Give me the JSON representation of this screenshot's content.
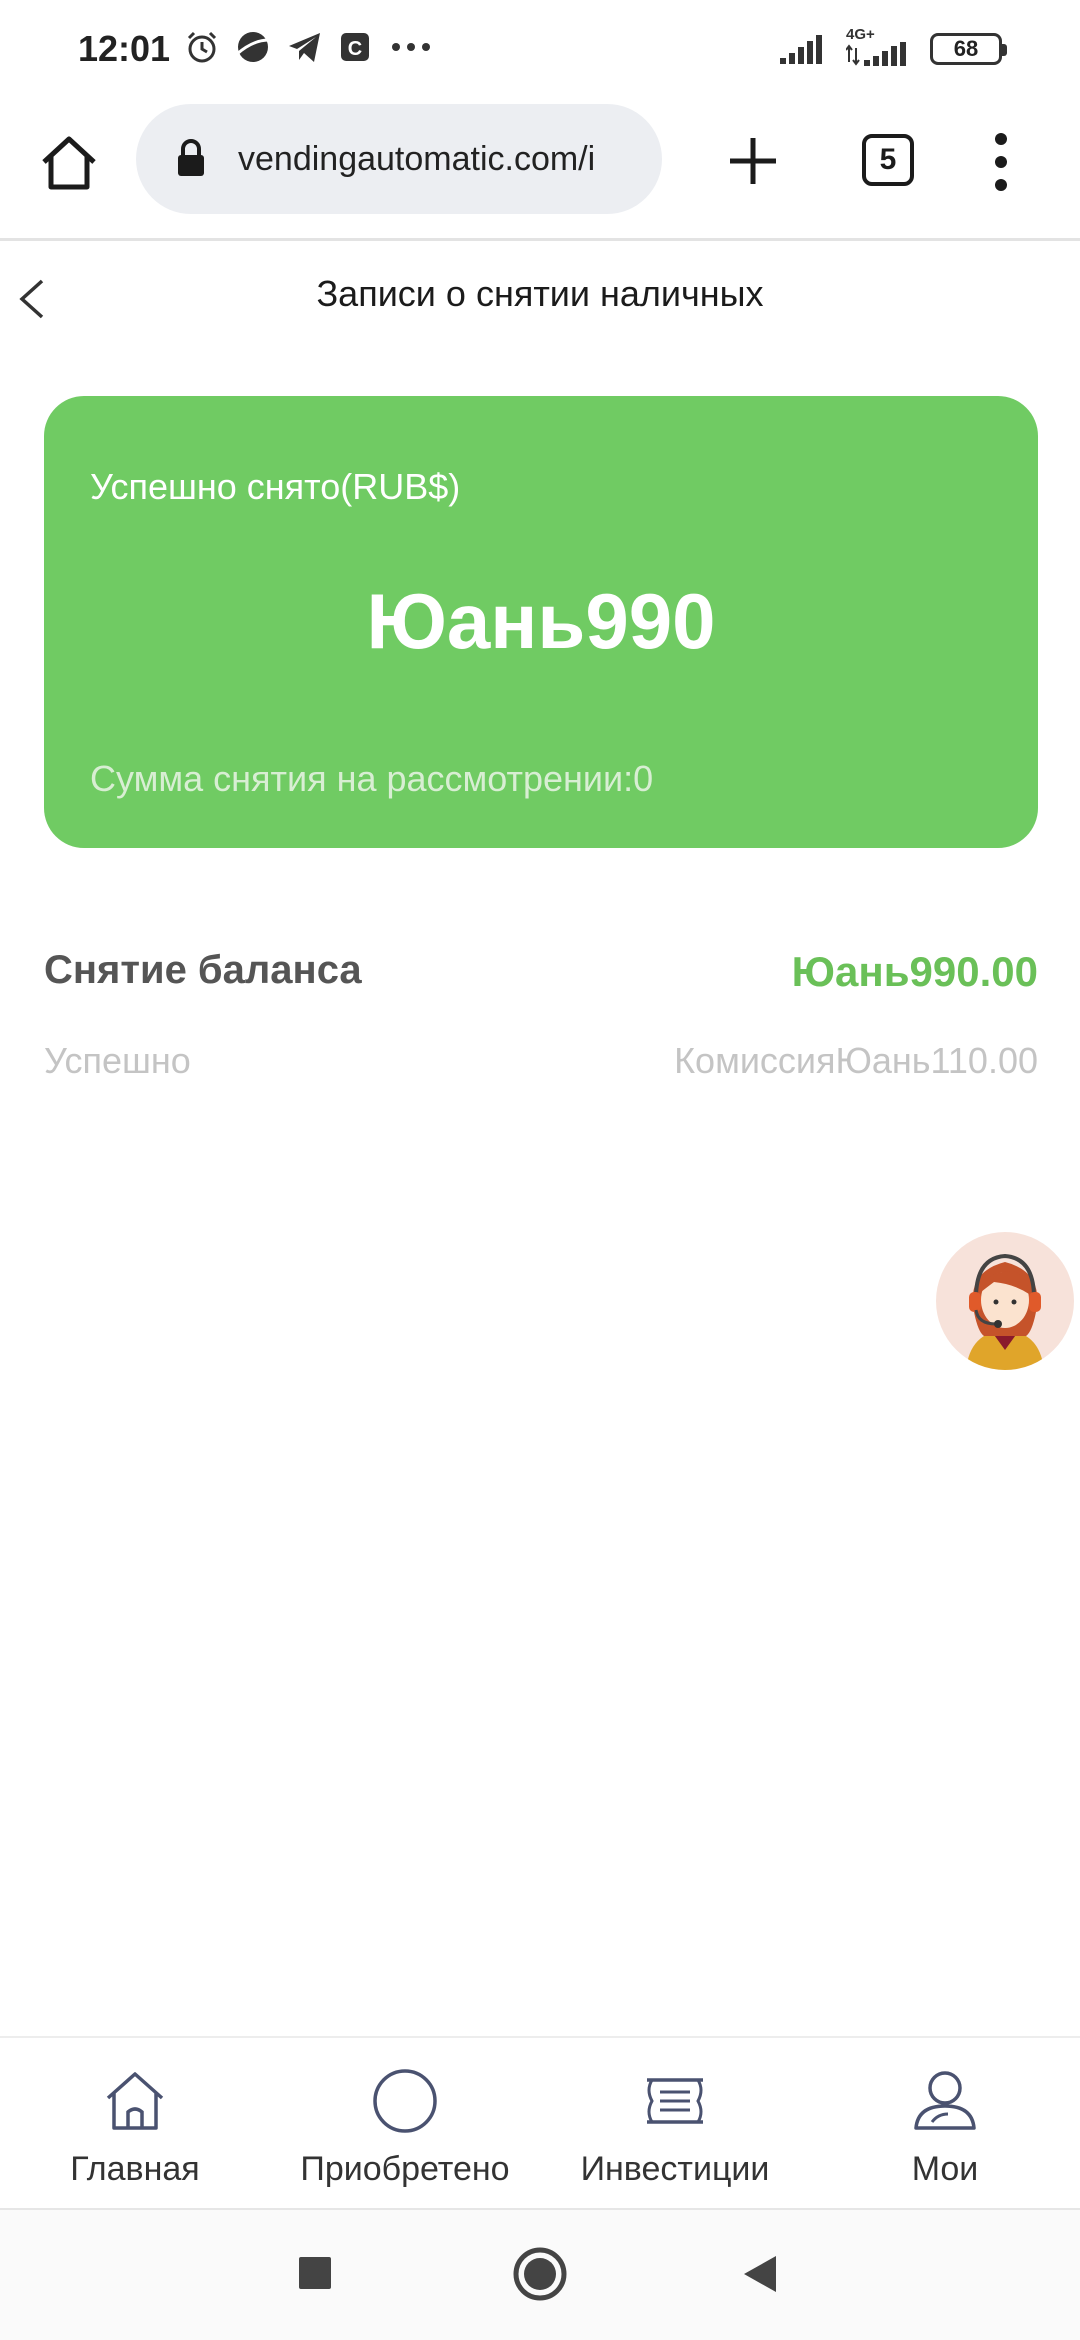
{
  "status_bar": {
    "time": "12:01",
    "network": "4G+",
    "battery": "68"
  },
  "browser": {
    "url": "vendingautomatic.com/i",
    "tab_count": "5"
  },
  "header": {
    "title": "Записи о снятии наличных"
  },
  "summary_card": {
    "label": "Успешно снято(RUB$)",
    "amount": "Юань990",
    "pending": "Сумма снятия на рассмотрении:0"
  },
  "records": [
    {
      "title": "Снятие баланса",
      "amount": "Юань990.00",
      "status": "Успешно",
      "fee": "КомиссияЮань110.00"
    }
  ],
  "bottom_nav": [
    {
      "label": "Главная",
      "icon": "home-icon"
    },
    {
      "label": "Приобретено",
      "icon": "circle-icon"
    },
    {
      "label": "Инвестиции",
      "icon": "list-icon"
    },
    {
      "label": "Мои",
      "icon": "user-icon"
    }
  ],
  "colors": {
    "card_green": "#70cb63",
    "amount_green": "#6ac058"
  }
}
